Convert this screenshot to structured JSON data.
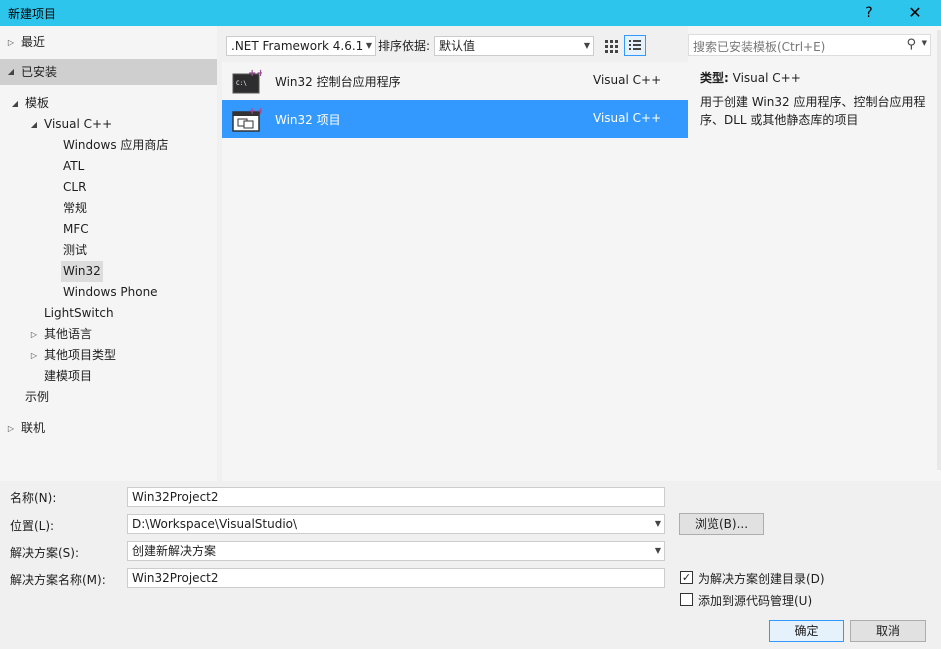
{
  "window": {
    "title": "新建项目",
    "help_symbol": "?",
    "close_symbol": "✕"
  },
  "left_tree": {
    "recent": "最近",
    "installed": "已安装",
    "templates": "模板",
    "visual_cpp": "Visual C++",
    "items": [
      "Windows 应用商店",
      "ATL",
      "CLR",
      "常规",
      "MFC",
      "测试",
      "Win32",
      "Windows Phone"
    ],
    "lightswitch": "LightSwitch",
    "other_languages": "其他语言",
    "other_project_types": "其他项目类型",
    "modeling_projects": "建模项目",
    "samples": "示例",
    "online": "联机"
  },
  "toolbar": {
    "framework": ".NET Framework 4.6.1",
    "sort_label": "排序依据:",
    "sort_value": "默认值"
  },
  "templates": [
    {
      "name": "Win32 控制台应用程序",
      "lang": "Visual C++",
      "icon": "console-app-icon"
    },
    {
      "name": "Win32 项目",
      "lang": "Visual C++",
      "icon": "win32-project-icon"
    }
  ],
  "search": {
    "placeholder": "搜索已安装模板(Ctrl+E)"
  },
  "description": {
    "type_label": "类型:",
    "type_value": "Visual C++",
    "text": "用于创建 Win32 应用程序、控制台应用程序、DLL 或其他静态库的项目"
  },
  "form": {
    "name_label": "名称(N):",
    "name_value": "Win32Project2",
    "location_label": "位置(L):",
    "location_value": "D:\\Workspace\\VisualStudio\\",
    "browse_button": "浏览(B)...",
    "solution_label": "解决方案(S):",
    "solution_value": "创建新解决方案",
    "solution_name_label": "解决方案名称(M):",
    "solution_name_value": "Win32Project2",
    "create_dir_label": "为解决方案创建目录(D)",
    "create_dir_checked": true,
    "source_control_label": "添加到源代码管理(U)",
    "source_control_checked": false,
    "ok_button": "确定",
    "cancel_button": "取消"
  },
  "colors": {
    "titlebar": "#2ec5ec",
    "selection": "#3399ff"
  }
}
